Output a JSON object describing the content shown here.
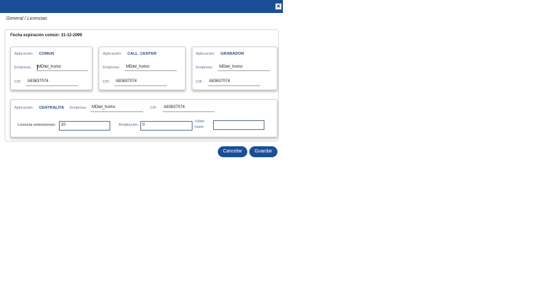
{
  "window": {
    "close_label": "×"
  },
  "breadcrumb": "General / Licencias",
  "fecha_expiracion": "Fecha expiración común: 31-12-2099",
  "labels": {
    "aplicacion": "Aplicación:",
    "empresa": "Empresa:",
    "cif": "CIF:",
    "licencia_extensiones": "Licencia extensiones:",
    "ampliacion": "Ampliación:",
    "valido_hasta_1": "Válido",
    "valido_hasta_2": "hasta:"
  },
  "cards": [
    {
      "app": "COMUN",
      "empresa": "MDtel_homo",
      "cif": "A83637074"
    },
    {
      "app": "CALL_CENTER",
      "empresa": "MDtel_homo",
      "cif": "A83637074"
    },
    {
      "app": "GRABADOR",
      "empresa": "MDtel_homo",
      "cif": "A83637074"
    }
  ],
  "centralita": {
    "app": "CENTRALITA",
    "empresa": "MDtel_homo",
    "cif": "A83637074",
    "licencia_extensiones": "20",
    "ampliacion": "0",
    "valido_hasta": ""
  },
  "buttons": {
    "cancel": "Cancelar",
    "save": "Guardar"
  },
  "colors": {
    "primary": "#1a4f96",
    "label": "#5d6f93",
    "app_name": "#2b4a7f"
  }
}
